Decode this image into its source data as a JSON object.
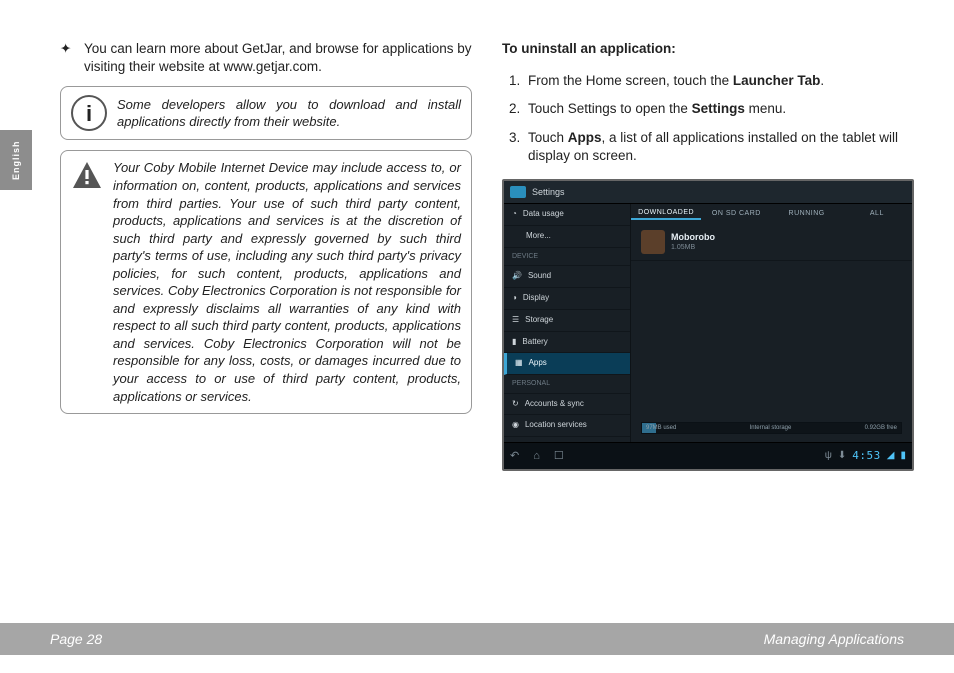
{
  "sideTab": "English",
  "left": {
    "bulletSym": "✦",
    "bullet": "You can learn more about GetJar, and browse for applications by visiting their website at www.getjar.com.",
    "infoText": "Some developers allow you to download and install applications directly from their website.",
    "warnText": "Your Coby Mobile Internet Device may include access to, or information on, content, products, applications and services from third parties. Your use of such third party content, products, applications and services is at the discretion of such third party and expressly governed by such third party's terms of use, including any such third party's privacy policies, for such content, products, applications and services. Coby Electronics Corporation is not responsible for and expressly disclaims all warranties of any kind with respect to all such third party content, products, applications and services. Coby Electronics Corporation will not be responsible for any loss, costs, or damages incurred due to your access to or use of third party content, products, applications or services."
  },
  "right": {
    "heading": "To uninstall an application:",
    "steps": {
      "s1a": "From the Home screen, touch the ",
      "s1b": "Launcher Tab",
      "s1c": ".",
      "s2a": "Touch Settings to open the ",
      "s2b": "Settings",
      "s2c": " menu.",
      "s3a": "Touch ",
      "s3b": "Apps",
      "s3c": ", a list of all applications installed on the tablet will display on screen."
    }
  },
  "shot": {
    "title": "Settings",
    "side": {
      "dataUsage": "Data usage",
      "more": "More...",
      "device": "DEVICE",
      "sound": "Sound",
      "display": "Display",
      "storage": "Storage",
      "battery": "Battery",
      "apps": "Apps",
      "personal": "PERSONAL",
      "accounts": "Accounts & sync",
      "location": "Location services"
    },
    "tabs": {
      "dl": "DOWNLOADED",
      "sd": "ON SD CARD",
      "run": "RUNNING",
      "all": "ALL"
    },
    "app": {
      "name": "Moborobo",
      "size": "1.05MB"
    },
    "storage": {
      "used": "97MB used",
      "label": "Internal storage",
      "free": "0.92GB free"
    },
    "clock": "4:53"
  },
  "footer": {
    "page": "Page 28",
    "section": "Managing Applications"
  }
}
